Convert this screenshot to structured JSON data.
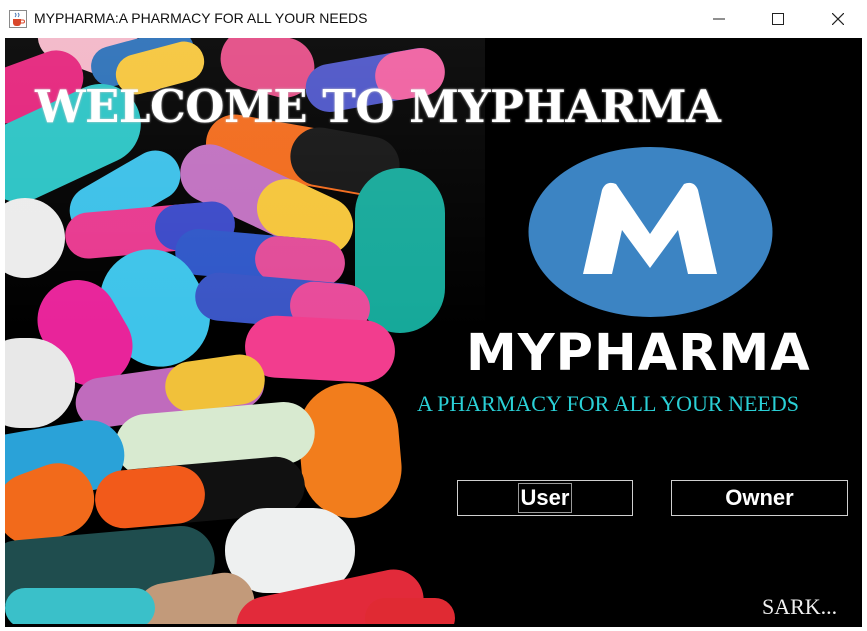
{
  "window": {
    "title": "MYPHARMA:A PHARMACY FOR ALL YOUR NEEDS",
    "icon": "java-cup-icon",
    "controls": [
      "minimize-icon",
      "maximize-icon",
      "close-icon"
    ]
  },
  "main": {
    "welcome": "WELCOME TO MYPHARMA",
    "logo_letter": "M",
    "brand": "MYPHARMA",
    "tagline": "A PHARMACY FOR ALL YOUR NEEDS",
    "buttons": {
      "user": "User",
      "owner": "Owner"
    },
    "footer": "SARK..."
  },
  "colors": {
    "background": "#000000",
    "logo_blue": "#3c84c3",
    "tagline": "#2ad0d6",
    "text": "#ffffff"
  }
}
